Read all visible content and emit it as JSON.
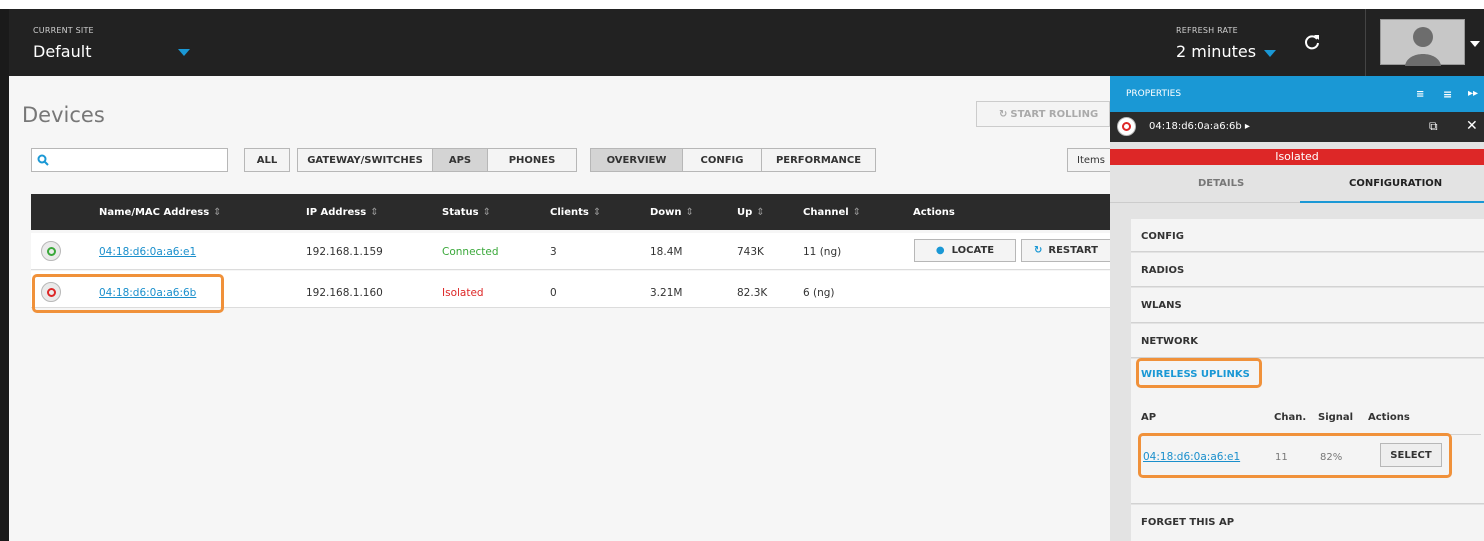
{
  "topbar": {
    "site_caption": "CURRENT SITE",
    "site_value": "Default",
    "refresh_caption": "REFRESH RATE",
    "refresh_value": "2 minutes"
  },
  "page": {
    "title": "Devices",
    "start_rolling": "START ROLLING",
    "search_placeholder": "",
    "items_label": "Items"
  },
  "filters": [
    "ALL",
    "GATEWAY/SWITCHES",
    "APS",
    "PHONES"
  ],
  "views": [
    "OVERVIEW",
    "CONFIG",
    "PERFORMANCE"
  ],
  "table": {
    "headers": [
      "Name/MAC Address",
      "IP Address",
      "Status",
      "Clients",
      "Down",
      "Up",
      "Channel",
      "Actions"
    ],
    "rows": [
      {
        "mac": "04:18:d6:0a:a6:e1",
        "ip": "192.168.1.159",
        "status": "Connected",
        "clients": "3",
        "down": "18.4M",
        "up": "743K",
        "channel": "11 (ng)",
        "locate": "LOCATE",
        "restart": "RESTART"
      },
      {
        "mac": "04:18:d6:0a:a6:6b",
        "ip": "192.168.1.160",
        "status": "Isolated",
        "clients": "0",
        "down": "3.21M",
        "up": "82.3K",
        "channel": "6 (ng)"
      }
    ]
  },
  "panel": {
    "title": "PROPERTIES",
    "device_mac": "04:18:d6:0a:a6:6b",
    "status": "Isolated",
    "tabs": [
      "DETAILS",
      "CONFIGURATION"
    ],
    "sections": [
      "CONFIG",
      "RADIOS",
      "WLANS",
      "NETWORK",
      "WIRELESS UPLINKS"
    ],
    "uplinks": {
      "headers": [
        "AP",
        "Chan.",
        "Signal",
        "Actions"
      ],
      "row": {
        "ap": "04:18:d6:0a:a6:e1",
        "chan": "11",
        "signal": "82%",
        "action": "SELECT"
      }
    },
    "forget": "FORGET THIS AP"
  },
  "colors": {
    "accent": "#1a98d5",
    "connected": "#3aa83a",
    "isolated": "#dd2727",
    "highlight": "#f0913a"
  }
}
